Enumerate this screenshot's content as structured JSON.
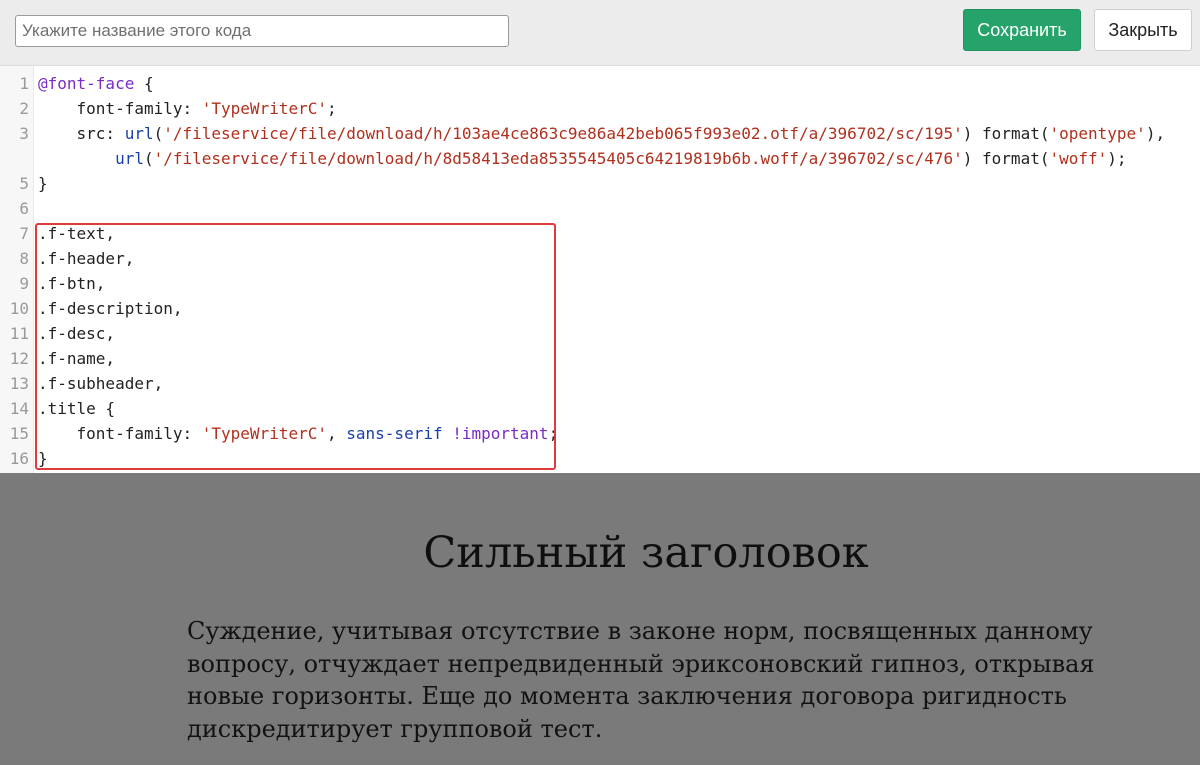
{
  "toolbar": {
    "name_placeholder": "Укажите название этого кода",
    "name_value": "",
    "save_label": "Сохранить",
    "close_label": "Закрыть"
  },
  "editor": {
    "lines": [
      {
        "n": "1",
        "tokens": [
          {
            "t": "@font-face",
            "c": "at"
          },
          {
            "t": " {",
            "c": "brace"
          }
        ]
      },
      {
        "n": "2",
        "tokens": [
          {
            "t": "    font-family: ",
            "c": "prop"
          },
          {
            "t": "'TypeWriterC'",
            "c": "str"
          },
          {
            "t": ";",
            "c": "prop"
          }
        ]
      },
      {
        "n": "3",
        "tokens": [
          {
            "t": "    src: ",
            "c": "prop"
          },
          {
            "t": "url",
            "c": "url"
          },
          {
            "t": "(",
            "c": "prop"
          },
          {
            "t": "'/fileservice/file/download/h/103ae4ce863c9e86a42beb065f993e02.otf/a/396702/sc/195'",
            "c": "str"
          },
          {
            "t": ") format(",
            "c": "prop"
          },
          {
            "t": "'opentype'",
            "c": "str"
          },
          {
            "t": "),",
            "c": "prop"
          }
        ]
      },
      {
        "n": "",
        "tokens": [
          {
            "t": "        ",
            "c": "prop"
          },
          {
            "t": "url",
            "c": "url"
          },
          {
            "t": "(",
            "c": "prop"
          },
          {
            "t": "'/fileservice/file/download/h/8d58413eda8535545405c64219819b6b.woff/a/396702/sc/476'",
            "c": "str"
          },
          {
            "t": ") format(",
            "c": "prop"
          },
          {
            "t": "'woff'",
            "c": "str"
          },
          {
            "t": ");",
            "c": "prop"
          }
        ]
      },
      {
        "n": "5",
        "tokens": [
          {
            "t": "}",
            "c": "brace"
          }
        ]
      },
      {
        "n": "6",
        "tokens": []
      },
      {
        "n": "7",
        "tokens": [
          {
            "t": ".f-text,",
            "c": "sel"
          }
        ]
      },
      {
        "n": "8",
        "tokens": [
          {
            "t": ".f-header,",
            "c": "sel"
          }
        ]
      },
      {
        "n": "9",
        "tokens": [
          {
            "t": ".f-btn,",
            "c": "sel"
          }
        ]
      },
      {
        "n": "10",
        "tokens": [
          {
            "t": ".f-description,",
            "c": "sel"
          }
        ]
      },
      {
        "n": "11",
        "tokens": [
          {
            "t": ".f-desc,",
            "c": "sel"
          }
        ]
      },
      {
        "n": "12",
        "tokens": [
          {
            "t": ".f-name,",
            "c": "sel"
          }
        ]
      },
      {
        "n": "13",
        "tokens": [
          {
            "t": ".f-subheader,",
            "c": "sel"
          }
        ]
      },
      {
        "n": "14",
        "tokens": [
          {
            "t": ".title {",
            "c": "sel"
          }
        ]
      },
      {
        "n": "15",
        "tokens": [
          {
            "t": "    font-family: ",
            "c": "prop"
          },
          {
            "t": "'TypeWriterC'",
            "c": "str"
          },
          {
            "t": ", ",
            "c": "prop"
          },
          {
            "t": "sans-serif",
            "c": "url"
          },
          {
            "t": " ",
            "c": "prop"
          },
          {
            "t": "!important",
            "c": "kw"
          },
          {
            "t": ";",
            "c": "prop"
          }
        ]
      },
      {
        "n": "16",
        "tokens": [
          {
            "t": "}",
            "c": "brace"
          }
        ]
      }
    ]
  },
  "preview": {
    "title": "Сильный заголовок",
    "text": "Суждение, учитывая отсутствие в законе норм, посвященных данному вопросу, отчуждает непредвиденный эриксоновский гипноз, открывая новые горизонты. Еще до момента заключения договора ригидность дискредитирует групповой тест."
  },
  "colors": {
    "save_button": "#26a36b",
    "highlight_border": "#e03a3a",
    "preview_background": "#7a7a7a",
    "string_token": "#b0301d",
    "url_token": "#1b3fa8",
    "keyword_token": "#7a2bc7"
  }
}
